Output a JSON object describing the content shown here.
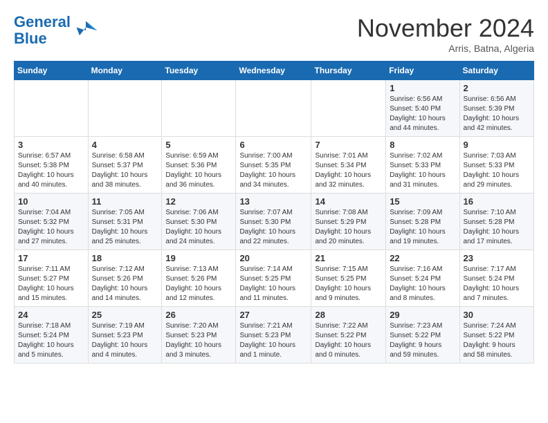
{
  "header": {
    "logo_line1": "General",
    "logo_line2": "Blue",
    "month_title": "November 2024",
    "location": "Arris, Batna, Algeria"
  },
  "columns": [
    "Sunday",
    "Monday",
    "Tuesday",
    "Wednesday",
    "Thursday",
    "Friday",
    "Saturday"
  ],
  "weeks": [
    [
      {
        "num": "",
        "info": ""
      },
      {
        "num": "",
        "info": ""
      },
      {
        "num": "",
        "info": ""
      },
      {
        "num": "",
        "info": ""
      },
      {
        "num": "",
        "info": ""
      },
      {
        "num": "1",
        "info": "Sunrise: 6:56 AM\nSunset: 5:40 PM\nDaylight: 10 hours\nand 44 minutes."
      },
      {
        "num": "2",
        "info": "Sunrise: 6:56 AM\nSunset: 5:39 PM\nDaylight: 10 hours\nand 42 minutes."
      }
    ],
    [
      {
        "num": "3",
        "info": "Sunrise: 6:57 AM\nSunset: 5:38 PM\nDaylight: 10 hours\nand 40 minutes."
      },
      {
        "num": "4",
        "info": "Sunrise: 6:58 AM\nSunset: 5:37 PM\nDaylight: 10 hours\nand 38 minutes."
      },
      {
        "num": "5",
        "info": "Sunrise: 6:59 AM\nSunset: 5:36 PM\nDaylight: 10 hours\nand 36 minutes."
      },
      {
        "num": "6",
        "info": "Sunrise: 7:00 AM\nSunset: 5:35 PM\nDaylight: 10 hours\nand 34 minutes."
      },
      {
        "num": "7",
        "info": "Sunrise: 7:01 AM\nSunset: 5:34 PM\nDaylight: 10 hours\nand 32 minutes."
      },
      {
        "num": "8",
        "info": "Sunrise: 7:02 AM\nSunset: 5:33 PM\nDaylight: 10 hours\nand 31 minutes."
      },
      {
        "num": "9",
        "info": "Sunrise: 7:03 AM\nSunset: 5:33 PM\nDaylight: 10 hours\nand 29 minutes."
      }
    ],
    [
      {
        "num": "10",
        "info": "Sunrise: 7:04 AM\nSunset: 5:32 PM\nDaylight: 10 hours\nand 27 minutes."
      },
      {
        "num": "11",
        "info": "Sunrise: 7:05 AM\nSunset: 5:31 PM\nDaylight: 10 hours\nand 25 minutes."
      },
      {
        "num": "12",
        "info": "Sunrise: 7:06 AM\nSunset: 5:30 PM\nDaylight: 10 hours\nand 24 minutes."
      },
      {
        "num": "13",
        "info": "Sunrise: 7:07 AM\nSunset: 5:30 PM\nDaylight: 10 hours\nand 22 minutes."
      },
      {
        "num": "14",
        "info": "Sunrise: 7:08 AM\nSunset: 5:29 PM\nDaylight: 10 hours\nand 20 minutes."
      },
      {
        "num": "15",
        "info": "Sunrise: 7:09 AM\nSunset: 5:28 PM\nDaylight: 10 hours\nand 19 minutes."
      },
      {
        "num": "16",
        "info": "Sunrise: 7:10 AM\nSunset: 5:28 PM\nDaylight: 10 hours\nand 17 minutes."
      }
    ],
    [
      {
        "num": "17",
        "info": "Sunrise: 7:11 AM\nSunset: 5:27 PM\nDaylight: 10 hours\nand 15 minutes."
      },
      {
        "num": "18",
        "info": "Sunrise: 7:12 AM\nSunset: 5:26 PM\nDaylight: 10 hours\nand 14 minutes."
      },
      {
        "num": "19",
        "info": "Sunrise: 7:13 AM\nSunset: 5:26 PM\nDaylight: 10 hours\nand 12 minutes."
      },
      {
        "num": "20",
        "info": "Sunrise: 7:14 AM\nSunset: 5:25 PM\nDaylight: 10 hours\nand 11 minutes."
      },
      {
        "num": "21",
        "info": "Sunrise: 7:15 AM\nSunset: 5:25 PM\nDaylight: 10 hours\nand 9 minutes."
      },
      {
        "num": "22",
        "info": "Sunrise: 7:16 AM\nSunset: 5:24 PM\nDaylight: 10 hours\nand 8 minutes."
      },
      {
        "num": "23",
        "info": "Sunrise: 7:17 AM\nSunset: 5:24 PM\nDaylight: 10 hours\nand 7 minutes."
      }
    ],
    [
      {
        "num": "24",
        "info": "Sunrise: 7:18 AM\nSunset: 5:24 PM\nDaylight: 10 hours\nand 5 minutes."
      },
      {
        "num": "25",
        "info": "Sunrise: 7:19 AM\nSunset: 5:23 PM\nDaylight: 10 hours\nand 4 minutes."
      },
      {
        "num": "26",
        "info": "Sunrise: 7:20 AM\nSunset: 5:23 PM\nDaylight: 10 hours\nand 3 minutes."
      },
      {
        "num": "27",
        "info": "Sunrise: 7:21 AM\nSunset: 5:23 PM\nDaylight: 10 hours\nand 1 minute."
      },
      {
        "num": "28",
        "info": "Sunrise: 7:22 AM\nSunset: 5:22 PM\nDaylight: 10 hours\nand 0 minutes."
      },
      {
        "num": "29",
        "info": "Sunrise: 7:23 AM\nSunset: 5:22 PM\nDaylight: 9 hours\nand 59 minutes."
      },
      {
        "num": "30",
        "info": "Sunrise: 7:24 AM\nSunset: 5:22 PM\nDaylight: 9 hours\nand 58 minutes."
      }
    ]
  ]
}
